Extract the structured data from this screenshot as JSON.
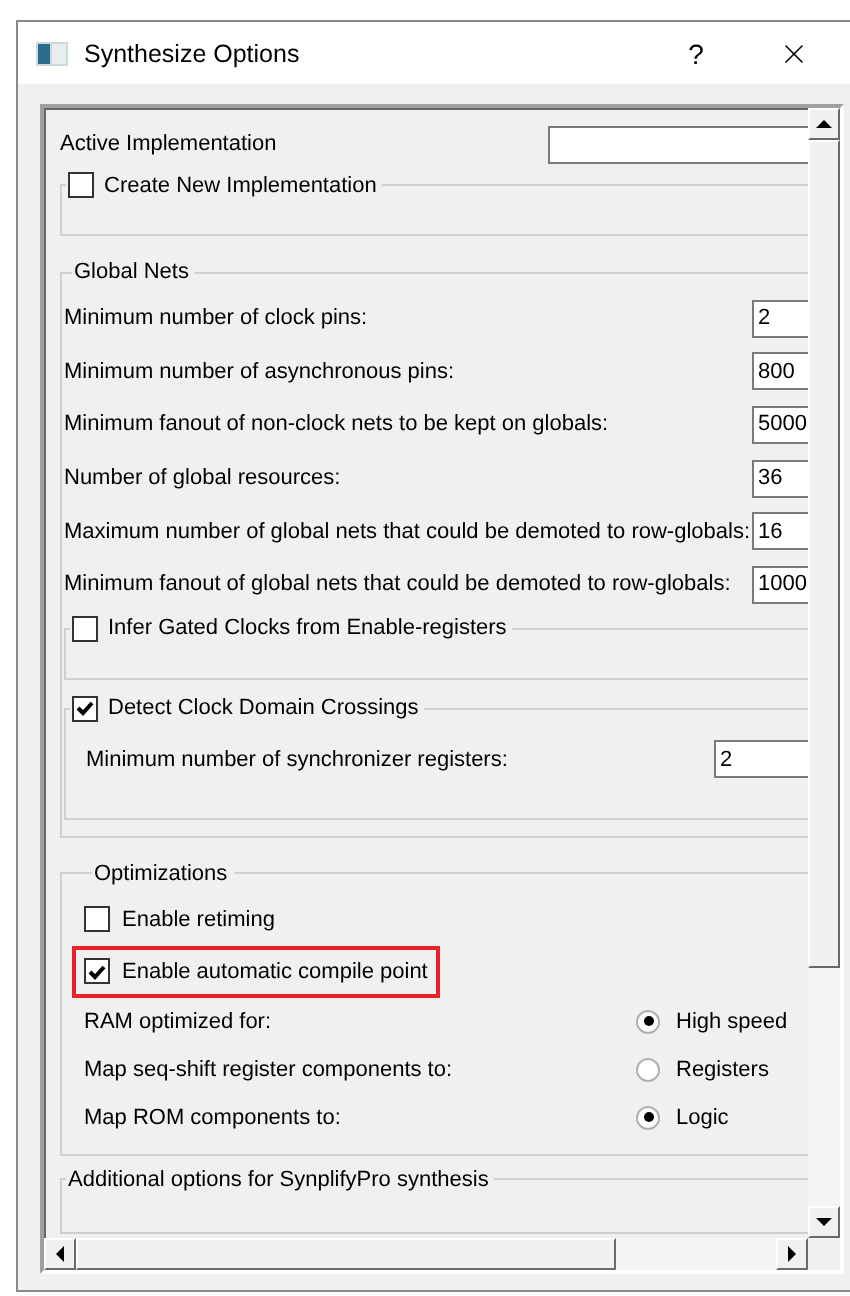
{
  "window": {
    "title": "Synthesize Options",
    "help": "?"
  },
  "active_implementation": {
    "label": "Active Implementation"
  },
  "create_new_implementation": {
    "label": "Create New Implementation",
    "checked": false
  },
  "global_nets": {
    "title": "Global Nets",
    "fields": [
      {
        "label": "Minimum number of clock pins:",
        "value": "2"
      },
      {
        "label": "Minimum number of asynchronous pins:",
        "value": "800"
      },
      {
        "label": "Minimum fanout of non-clock nets to be kept on globals:",
        "value": "5000"
      },
      {
        "label": "Number of global resources:",
        "value": "36"
      },
      {
        "label": "Maximum number of global nets that could be demoted to row-globals:",
        "value": "16"
      },
      {
        "label": "Minimum fanout of global nets that could be demoted to row-globals:",
        "value": "1000"
      }
    ],
    "infer_gated_clocks": {
      "label": "Infer Gated Clocks from Enable-registers",
      "checked": false
    },
    "detect_clock_domain_crossings": {
      "label": "Detect Clock Domain Crossings",
      "checked": true,
      "fields": [
        {
          "label": "Minimum number of synchronizer registers:",
          "value": "2"
        }
      ]
    }
  },
  "optimizations": {
    "title": "Optimizations",
    "checkboxes": [
      {
        "label": "Enable retiming",
        "checked": false,
        "highlighted": false
      },
      {
        "label": "Enable automatic compile point",
        "checked": true,
        "highlighted": true
      }
    ],
    "options": [
      {
        "label": "RAM optimized for:",
        "choice": "High speed",
        "selected": true
      },
      {
        "label": "Map seq-shift register components to:",
        "choice": "Registers",
        "selected": false
      },
      {
        "label": "Map ROM components to:",
        "choice": "Logic",
        "selected": true
      }
    ]
  },
  "additional_options": {
    "title": "Additional options for SynplifyPro synthesis"
  }
}
